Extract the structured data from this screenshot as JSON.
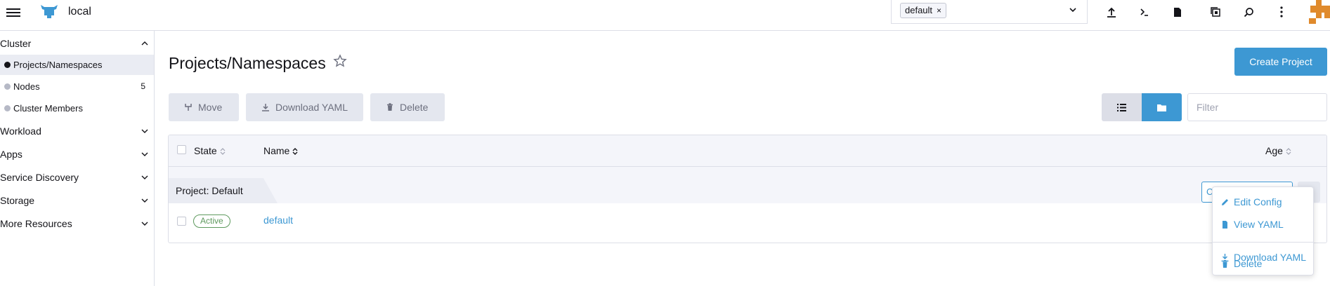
{
  "header": {
    "cluster_name": "local",
    "namespace_chip": "default",
    "chip_remove": "×",
    "icons": [
      "upload-icon",
      "terminal-icon",
      "file-icon",
      "copy-config-icon",
      "search-icon",
      "more-vertical-icon"
    ]
  },
  "sidebar": {
    "groups": [
      {
        "label": "Cluster",
        "expanded": true
      },
      {
        "label": "Workload"
      },
      {
        "label": "Apps"
      },
      {
        "label": "Service Discovery"
      },
      {
        "label": "Storage"
      },
      {
        "label": "More Resources"
      }
    ],
    "items": [
      {
        "label": "Projects/Namespaces",
        "active": true
      },
      {
        "label": "Nodes",
        "count": "5"
      },
      {
        "label": "Cluster Members"
      }
    ]
  },
  "page": {
    "title": "Projects/Namespaces",
    "create_button": "Create Project",
    "actions": {
      "move": "Move",
      "download_yaml": "Download YAML",
      "delete": "Delete"
    },
    "filter_placeholder": "Filter"
  },
  "table": {
    "columns": {
      "state": "State",
      "name": "Name",
      "age": "Age"
    },
    "group_label": "Project: Default",
    "group_button_partial": "C",
    "rows": [
      {
        "state": "Active",
        "name": "default"
      }
    ]
  },
  "menu": {
    "items": [
      {
        "label": "Edit Config",
        "icon": "pencil-icon"
      },
      {
        "label": "View YAML",
        "icon": "file-icon"
      },
      {
        "label": "Download YAML",
        "icon": "download-icon"
      },
      {
        "label": "Delete",
        "icon": "trash-icon"
      }
    ]
  },
  "colors": {
    "accent": "#3d98d3",
    "active_badge": "#5d995d",
    "avatar": "#e08a2c"
  }
}
